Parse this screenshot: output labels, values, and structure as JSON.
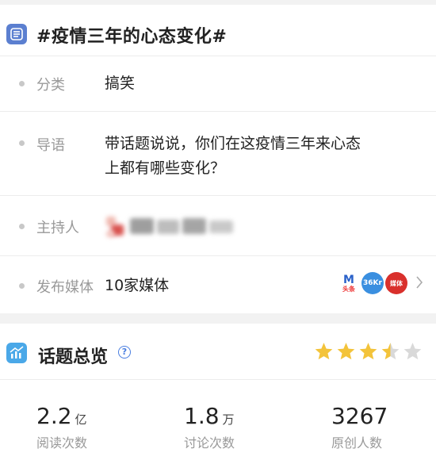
{
  "topic": {
    "title": "#疫情三年的心态变化#",
    "icon": "list-doc-icon"
  },
  "rows": {
    "category": {
      "label": "分类",
      "value": "搞笑"
    },
    "intro": {
      "label": "导语",
      "line1": "带话题说说，你们在这疫情三年来心态",
      "line2": "上都有哪些变化？"
    },
    "host": {
      "label": "主持人"
    },
    "media": {
      "label": "发布媒体",
      "value": "10家媒体",
      "logos": [
        "头条",
        "36Kr",
        "媒体"
      ]
    }
  },
  "overview": {
    "title": "话题总览",
    "help": "?",
    "rating": 3.5,
    "stats": [
      {
        "num": "2.2",
        "unit": "亿",
        "label": "阅读次数"
      },
      {
        "num": "1.8",
        "unit": "万",
        "label": "讨论次数"
      },
      {
        "num": "3267",
        "unit": "",
        "label": "原创人数"
      }
    ]
  },
  "colors": {
    "accent": "#5b7fd0",
    "star": "#f3c33a",
    "star_empty": "#d9d9d9",
    "muted": "#999999"
  }
}
